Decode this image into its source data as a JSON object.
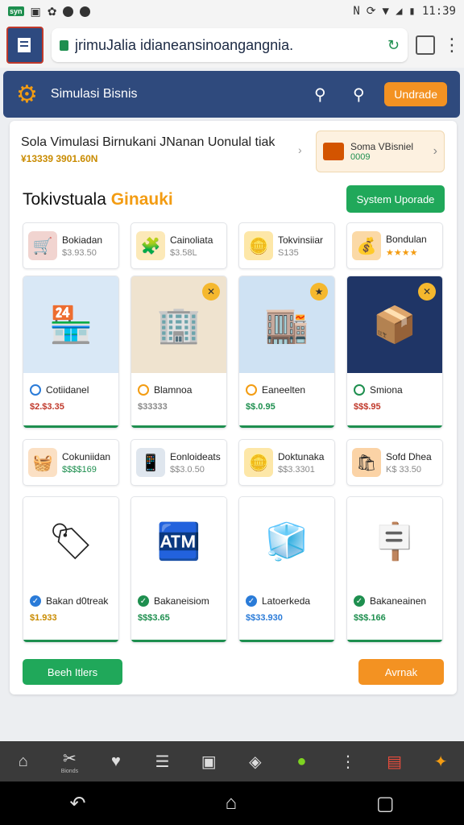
{
  "status_bar": {
    "time": "11:39"
  },
  "browser": {
    "url": "jrimuJalia idianeansinoangangnia."
  },
  "app_header": {
    "title": "Simulasi Bisnis",
    "upgrade_label": "Undrade"
  },
  "banner": {
    "title": "Sola Vimulasi Birnukani JNanan Uonulal tiak",
    "subtitle": "¥13339 3901.60N",
    "promo_title": "Soma VBisniel",
    "promo_value": "0009"
  },
  "section": {
    "title": "Tokivstuala ",
    "title_accent": "Ginauki",
    "system_button": "System Uporade"
  },
  "row1_mini": [
    {
      "name": "Bokiadan",
      "price": "$3.93.50",
      "icon": "cart-icon"
    },
    {
      "name": "Cainoliata",
      "price": "$3.58L",
      "icon": "puzzle-icon"
    },
    {
      "name": "Tokvinsiiar",
      "price": "S135",
      "icon": "coin-icon"
    },
    {
      "name": "Bondulan",
      "price": "★★★★",
      "icon": "coin-bag-icon"
    }
  ],
  "row1_big": [
    {
      "name": "Cotiidanel",
      "price": "$2.$3.35",
      "icon": "shop-counter-icon"
    },
    {
      "name": "Blamnoa",
      "price": "$33333",
      "icon": "office-icon"
    },
    {
      "name": "Eaneelten",
      "price": "$$.0.95",
      "icon": "store-shelves-icon"
    },
    {
      "name": "Smiona",
      "price": "$$$.95",
      "icon": "boxes-icon"
    }
  ],
  "row2_mini": [
    {
      "name": "Cokuniidan",
      "price": "$$$$169",
      "icon": "basket-icon"
    },
    {
      "name": "Eonloideats",
      "price": "$$3.0.50",
      "icon": "phone-icon"
    },
    {
      "name": "Doktunaka",
      "price": "$$3.3301",
      "icon": "coin-stack-icon"
    },
    {
      "name": "Sofd Dhea",
      "price": "K$ 33.50",
      "icon": "shopping-bag-icon"
    }
  ],
  "row2_big": [
    {
      "name": "Bakan d0treak",
      "price": "$1.933",
      "icon": "kiosk-icon"
    },
    {
      "name": "Bakaneisiom",
      "price": "$$$3.65",
      "icon": "vendor-icon"
    },
    {
      "name": "Latoerkeda",
      "price": "$$33.930",
      "icon": "fridge-icon"
    },
    {
      "name": "Bakaneainen",
      "price": "$$$.166",
      "icon": "sign-icon"
    }
  ],
  "buttons": {
    "left": "Beeh Itlers",
    "right": "Avrnak"
  },
  "toolbar": {
    "label_2": "Bionds"
  }
}
